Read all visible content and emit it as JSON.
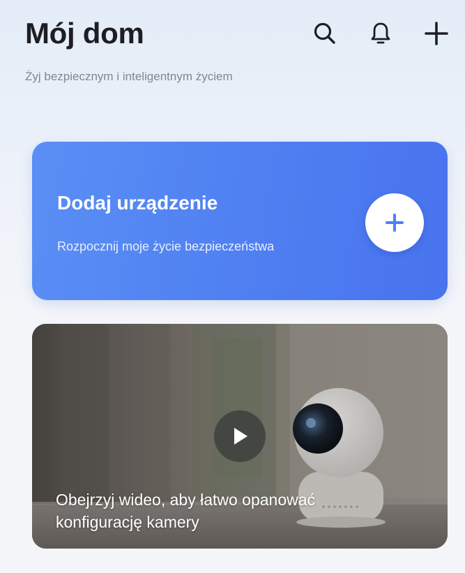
{
  "header": {
    "title": "Mój dom",
    "subtitle": "Żyj bezpiecznym i inteligentnym życiem",
    "icons": [
      "search-icon",
      "bell-icon",
      "plus-icon"
    ]
  },
  "add_device_card": {
    "title": "Dodaj urządzenie",
    "subtitle": "Rozpocznij moje życie bezpieczeństwa",
    "icon": "plus-icon",
    "accent": "#4f7ff1"
  },
  "video_card": {
    "caption": "Obejrzyj wideo, aby łatwo opanować konfigurację kamery",
    "icon": "play-icon"
  },
  "colors": {
    "title": "#1e1e22",
    "subtitle": "#7d8796",
    "card_blue": "#4f7ff1"
  }
}
